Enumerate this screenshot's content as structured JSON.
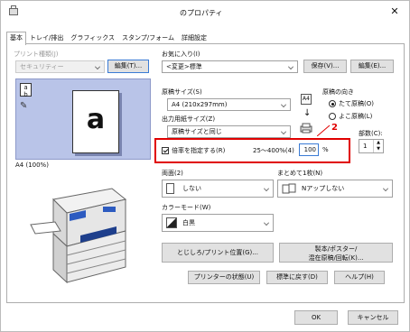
{
  "window": {
    "title": "のプロパティ",
    "close_glyph": "✕"
  },
  "tabs": [
    "基本",
    "トレイ/排出",
    "グラフィックス",
    "スタンプ/フォーム",
    "詳細設定"
  ],
  "printer_type": {
    "label": "プリント種類(J)",
    "value": "セキュリティー",
    "edit_button": "編集(T)..."
  },
  "favorites": {
    "label": "お気に入り(I)",
    "value": "<変更>標準",
    "save_button": "保存(V)...",
    "edit_button": "編集(E)..."
  },
  "preview": {
    "letter": "a",
    "caption": "A4 (100%)"
  },
  "original_size": {
    "label": "原稿サイズ(S)",
    "value": "A4 (210x297mm)"
  },
  "output_size": {
    "label": "出力用紙サイズ(Z)",
    "value": "原稿サイズと同じ"
  },
  "orientation": {
    "label": "原稿の向き",
    "options": [
      "たて原稿(O)",
      "よこ原稿(L)"
    ],
    "selected": 0
  },
  "scale": {
    "label": "倍率を指定する(R)",
    "range": "25～400%(4)",
    "value": "100",
    "unit": "%",
    "checked": true
  },
  "annotation_number": "2",
  "copies": {
    "label": "部数(C):",
    "value": "1"
  },
  "duplex": {
    "label": "両面(2)",
    "value": "しない"
  },
  "nup": {
    "label": "まとめて1枚(N)",
    "value": "Nアップしない"
  },
  "color_mode": {
    "label": "カラーモード(W)",
    "value": "白黒"
  },
  "buttons": {
    "binding": "とじしろ/プリント位置(G)...",
    "booklet_line1": "製本/ポスター/",
    "booklet_line2": "混在原稿/回転(K)...",
    "printer_status": "プリンターの状態(U)",
    "restore_default": "標準に戻す(D)",
    "help": "ヘルプ(H)",
    "ok": "OK",
    "cancel": "キャンセル"
  },
  "colors": {
    "accent": "#e00000",
    "focus": "#3a7bd5",
    "button": "#e1e1e1"
  }
}
